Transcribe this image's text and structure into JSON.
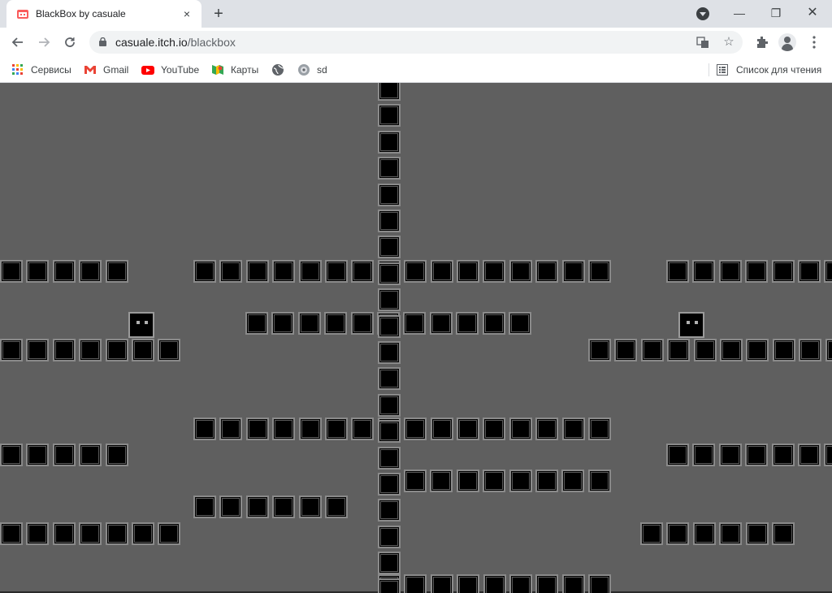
{
  "tab": {
    "title": "BlackBox by casuale",
    "close_glyph": "×"
  },
  "new_tab_glyph": "+",
  "window_controls": {
    "minimize": "—",
    "restore": "❐",
    "close": "✕"
  },
  "address_bar": {
    "host": "casuale.itch.io",
    "path": "/blackbox"
  },
  "bookmarks": [
    {
      "label": "Сервисы",
      "icon": "apps-grid-icon"
    },
    {
      "label": "Gmail",
      "icon": "gmail-icon"
    },
    {
      "label": "YouTube",
      "icon": "youtube-icon"
    },
    {
      "label": "Карты",
      "icon": "maps-icon"
    },
    {
      "label": "",
      "icon": "globe-icon"
    },
    {
      "label": "sd",
      "icon": "sd-icon"
    }
  ],
  "reading_list": "Список для чтения",
  "colors": {
    "background": "#5f5f5f",
    "block": "#000000",
    "block_border": "#8a8a8a",
    "character_eyes": "#b0b0b0",
    "tab_strip": "#dee1e6"
  },
  "game": {
    "title": "BlackBox",
    "characters": 2
  }
}
